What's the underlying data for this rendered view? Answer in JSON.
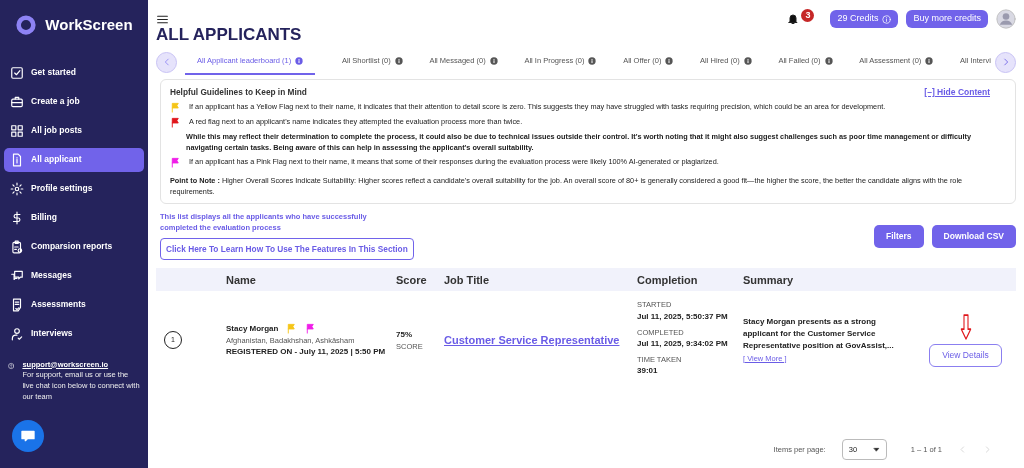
{
  "sidebar": {
    "logo": "WorkScreen",
    "items": [
      {
        "label": "Get started",
        "selected": false
      },
      {
        "label": "Create a job",
        "selected": false
      },
      {
        "label": "All job posts",
        "selected": false
      },
      {
        "label": "All applicant",
        "selected": true
      },
      {
        "label": "Profile settings",
        "selected": false
      },
      {
        "label": "Billing",
        "selected": false
      },
      {
        "label": "Comparsion reports",
        "selected": false
      },
      {
        "label": "Messages",
        "selected": false
      },
      {
        "label": "Assessments",
        "selected": false
      },
      {
        "label": "Interviews",
        "selected": false
      }
    ],
    "support": {
      "email": "support@workscreen.io",
      "text": "For support, email us or use the live chat icon below to connect with our team"
    }
  },
  "topbar": {
    "notification_count": "3",
    "credits": "29 Credits",
    "buy_button": "Buy more credits"
  },
  "page_title": "ALL APPLICANTS",
  "tabs": [
    {
      "label": "All Applicant leaderboard (1)",
      "selected": true
    },
    {
      "label": "All Shortlist (0)",
      "selected": false
    },
    {
      "label": "All Messaged (0)",
      "selected": false
    },
    {
      "label": "All In Progress (0)",
      "selected": false
    },
    {
      "label": "All Offer (0)",
      "selected": false
    },
    {
      "label": "All Hired (0)",
      "selected": false
    },
    {
      "label": "All Failed (0)",
      "selected": false
    },
    {
      "label": "All Assessment (0)",
      "selected": false
    },
    {
      "label": "All Intervi",
      "selected": false
    }
  ],
  "guidelines": {
    "title": "Helpful Guidelines to Keep in Mind",
    "hide_link": "[–] Hide Content",
    "items": [
      {
        "kind": "flag",
        "color": "#f5c518",
        "text": "If an applicant has a Yellow Flag next to their name, it indicates that their attention to detail score is zero. This suggests they may have struggled with tasks requiring precision, which could be an area for development."
      },
      {
        "kind": "flag",
        "color": "#e0161b",
        "text": "A red flag next to an applicant's name indicates they attempted the evaluation process more than twice."
      },
      {
        "kind": "note",
        "text": "While this may reflect their determination to complete the process, it could also be due to technical issues outside their control. It's worth noting that it might also suggest challenges such as poor time management or difficulty navigating certain tasks. Being aware of this can help in assessing the applicant's overall suitability."
      },
      {
        "kind": "flag",
        "color": "#f01ee8",
        "text": "If an applicant has a Pink Flag next to their name, it means that some of their responses during the evaluation process were likely 100% AI-generated or plagiarized."
      }
    ],
    "point_to_note": "**Point to Note :** Higher Overall Scores Indicate Suitability: Higher scores reflect a candidate's overall suitability for the job. An overall score of 80+ is generally considered a good fit—the higher the score, the better the candidate aligns with the role requirements."
  },
  "intro": {
    "text": "This list displays all the applicants who have successfully completed the evaluation process",
    "learn_button": "Click Here To Learn How To Use The Features In This Section"
  },
  "actions": [
    "Filters",
    "Download CSV"
  ],
  "table": {
    "columns": [
      "Name",
      "Score",
      "Job Title",
      "Completion",
      "Summary"
    ],
    "rows": [
      {
        "rank": "1",
        "name": "Stacy Morgan",
        "flags": [
          {
            "color": "#f5c518"
          },
          {
            "color": "#f01ee8"
          }
        ],
        "location": "Afghanistan, Badakhshan, Ashkāsham",
        "registered": "REGISTERED ON - July 11, 2025 | 5:50 PM",
        "score": "75%",
        "score_label": "SCORE",
        "job_title": "Customer Service Representative",
        "completion": [
          {
            "label": "STARTED",
            "value": "Jul 11, 2025, 5:50:37 PM"
          },
          {
            "label": "COMPLETED",
            "value": "Jul 11, 2025, 9:34:02 PM"
          },
          {
            "label": "TIME TAKEN",
            "value": "39:01"
          }
        ],
        "summary": "Stacy Morgan presents as a strong applicant for the Customer Service Representative position at GovAssist,...",
        "view_more": "[ View More ]",
        "action": "View Details"
      }
    ]
  },
  "pagination": {
    "label": "Items per page:",
    "value": "30",
    "range": "1 – 1 of 1"
  }
}
